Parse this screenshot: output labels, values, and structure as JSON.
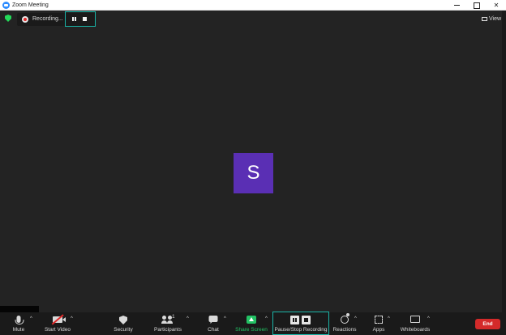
{
  "window": {
    "title": "Zoom Meeting",
    "controls": {
      "minimize": "",
      "maximize": "",
      "close": "✕"
    }
  },
  "topbar": {
    "recording_status": "Recording...",
    "view_label": "View"
  },
  "participant": {
    "avatar_initial": "S"
  },
  "toolbar": {
    "mute": "Mute",
    "start_video": "Start Video",
    "security": "Security",
    "participants": "Participants",
    "participants_count": "1",
    "chat": "Chat",
    "share_screen": "Share Screen",
    "pause_stop_recording": "Pause/Stop Recording",
    "reactions": "Reactions",
    "apps": "Apps",
    "whiteboards": "Whiteboards",
    "end": "End",
    "caret": "^"
  },
  "colors": {
    "stage_bg": "#232323",
    "toolbar_bg": "#1a1a1a",
    "avatar_bg": "#5a2fb4",
    "highlight_box": "#1ab5a8",
    "share_green": "#23c264",
    "end_red": "#d42a2a"
  },
  "icons": [
    "zoom-logo-icon",
    "shield-icon",
    "record-icon",
    "pause-icon",
    "stop-icon",
    "view-icon",
    "mic-icon",
    "video-off-icon",
    "security-icon",
    "participants-icon",
    "chat-icon",
    "share-screen-icon",
    "reactions-icon",
    "apps-icon",
    "whiteboards-icon"
  ]
}
